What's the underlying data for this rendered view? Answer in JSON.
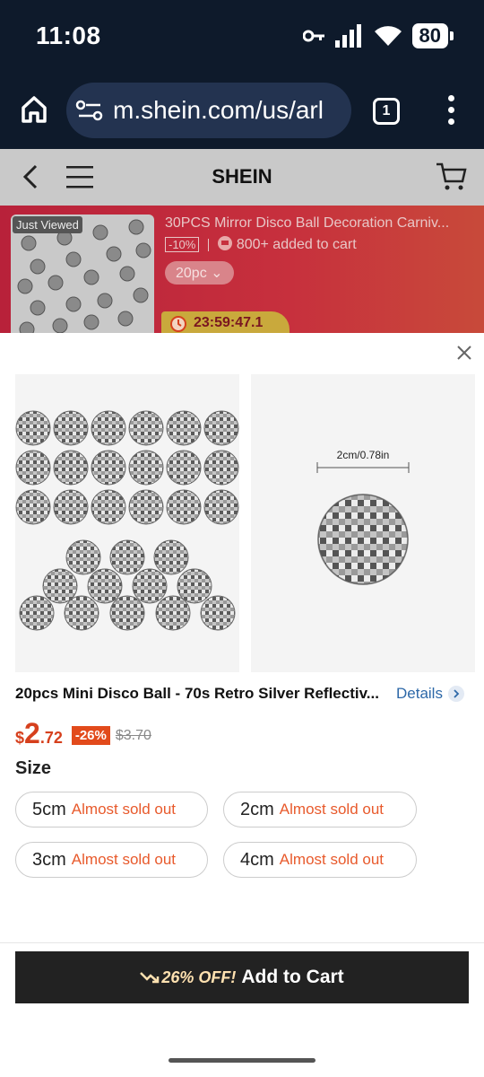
{
  "status": {
    "time": "11:08",
    "battery": "80"
  },
  "browser": {
    "url": "m.shein.com/us/arl",
    "tab_count": "1"
  },
  "header": {
    "logo": "SHEIN"
  },
  "banner": {
    "badge": "Just Viewed",
    "title": "30PCS Mirror Disco Ball Decoration Carniv...",
    "discount": "-10%",
    "added_to_cart": "800+ added to cart",
    "variant": "20pc",
    "timer": "23:59:47.1"
  },
  "product": {
    "size_annotation": "2cm/0.78in",
    "title": "20pcs Mini Disco Ball - 70s Retro Silver Reflectiv...",
    "details_label": "Details",
    "price_currency": "$",
    "price_int": "2",
    "price_dec": ".72",
    "discount_badge": "-26%",
    "original_price": "$3.70",
    "size_label": "Size",
    "sizes": [
      {
        "value": "5cm",
        "note": "Almost sold out"
      },
      {
        "value": "2cm",
        "note": "Almost sold out"
      },
      {
        "value": "3cm",
        "note": "Almost sold out"
      },
      {
        "value": "4cm",
        "note": "Almost sold out"
      }
    ]
  },
  "cta": {
    "promo": "26% OFF!",
    "label": "Add to Cart"
  },
  "colors": {
    "accent": "#e24a1b",
    "dark": "#222222",
    "banner": "#c7303d"
  }
}
